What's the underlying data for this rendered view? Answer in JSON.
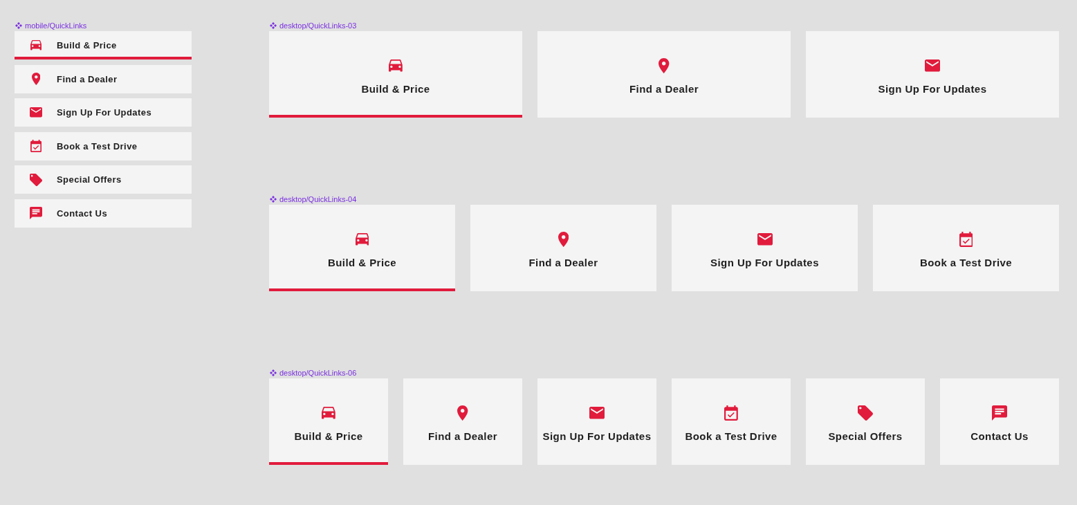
{
  "sections": [
    {
      "kind": "list",
      "title": "mobile/QuickLinks",
      "items": [
        {
          "label": "Build & Price",
          "selected": true
        },
        {
          "label": "Find a Dealer",
          "selected": false
        },
        {
          "label": "Sign Up For Updates",
          "selected": false
        },
        {
          "label": "Book a Test Drive",
          "selected": false
        },
        {
          "label": "Special Offers",
          "selected": false
        },
        {
          "label": "Contact Us",
          "selected": false
        }
      ]
    },
    {
      "kind": "cards",
      "title": "desktop/QuickLinks-03",
      "items": [
        {
          "label": "Build & Price",
          "selected": true
        },
        {
          "label": "Find a Dealer",
          "selected": false
        },
        {
          "label": "Sign Up For Updates",
          "selected": false
        }
      ]
    },
    {
      "kind": "cards",
      "title": "desktop/QuickLinks-04",
      "items": [
        {
          "label": "Build & Price",
          "selected": true
        },
        {
          "label": "Find a Dealer",
          "selected": false
        },
        {
          "label": "Sign Up For Updates",
          "selected": false
        },
        {
          "label": "Book a Test Drive",
          "selected": false
        }
      ]
    },
    {
      "kind": "cards",
      "title": "desktop/QuickLinks-06",
      "items": [
        {
          "label": "Build & Price",
          "selected": true
        },
        {
          "label": "Find a Dealer",
          "selected": false
        },
        {
          "label": "Sign Up For Updates",
          "selected": false
        },
        {
          "label": "Book a Test Drive",
          "selected": false
        },
        {
          "label": "Special Offers",
          "selected": false
        },
        {
          "label": "Contact Us",
          "selected": false
        }
      ]
    }
  ]
}
